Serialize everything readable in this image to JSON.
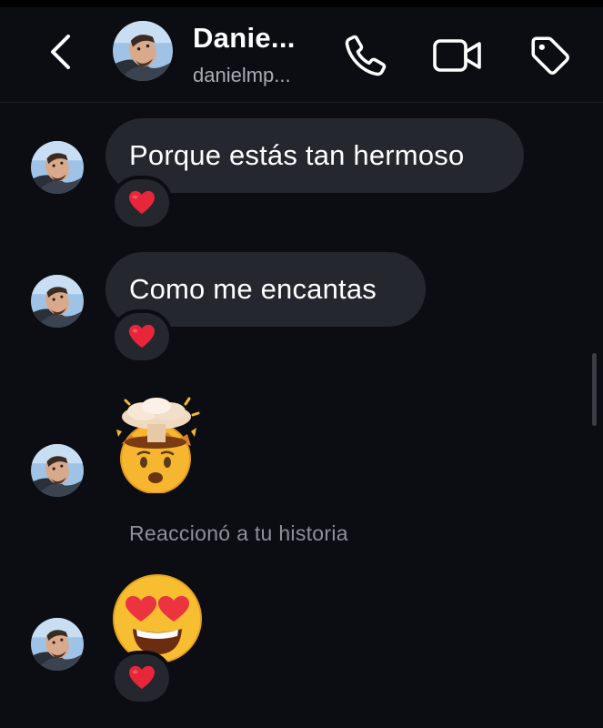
{
  "header": {
    "contact_name": "Danie...",
    "contact_username": "danielmp..."
  },
  "messages": [
    {
      "type": "text",
      "text": "Porque estás tan hermoso",
      "reaction": "heart"
    },
    {
      "type": "text",
      "text": "Como me encantas",
      "reaction": "heart"
    },
    {
      "type": "emoji",
      "emoji": "exploding-head"
    },
    {
      "type": "note",
      "text": "Reaccionó a tu historia"
    },
    {
      "type": "emoji",
      "emoji": "heart-eyes",
      "reaction": "heart"
    }
  ],
  "colors": {
    "background": "#0b0d12",
    "bubble": "#25272e",
    "heart": "#e8263a",
    "secondary_text": "#a8acb4"
  }
}
